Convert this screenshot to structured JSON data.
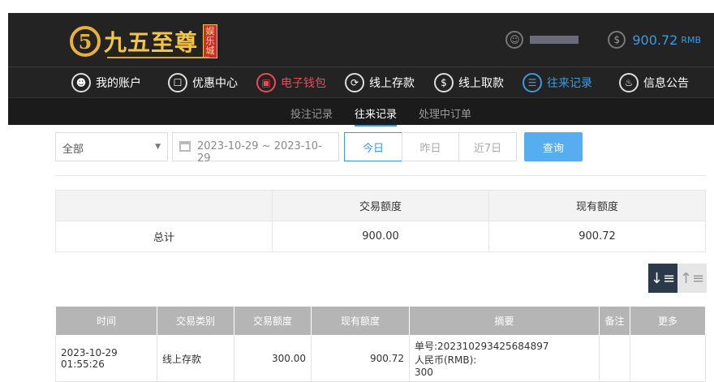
{
  "brand": {
    "mark": "5",
    "name": "九五至尊",
    "badge": "娱乐城"
  },
  "account": {
    "balance": "900.72",
    "currency": "RMB"
  },
  "nav": {
    "items": [
      {
        "label": "我的账户",
        "icon": "user-icon"
      },
      {
        "label": "优惠中心",
        "icon": "gift-icon"
      },
      {
        "label": "电子钱包",
        "icon": "wallet-icon"
      },
      {
        "label": "线上存款",
        "icon": "deposit-icon"
      },
      {
        "label": "线上取款",
        "icon": "withdraw-icon"
      },
      {
        "label": "往来记录",
        "icon": "records-icon"
      },
      {
        "label": "信息公告",
        "icon": "bell-icon"
      }
    ]
  },
  "subnav": {
    "tabs": [
      "投注记录",
      "往来记录",
      "处理中订单"
    ]
  },
  "filters": {
    "type_selected": "全部",
    "date_range": "2023-10-29 ~ 2023-10-29",
    "quick": [
      "今日",
      "昨日",
      "近7日"
    ],
    "search_label": "查询"
  },
  "summary": {
    "headers": [
      "",
      "交易额度",
      "现有额度"
    ],
    "row": [
      "总计",
      "900.00",
      "900.72"
    ]
  },
  "records": {
    "headers": [
      "时间",
      "交易类别",
      "交易额度",
      "现有额度",
      "摘要",
      "备注",
      "更多"
    ],
    "rows": [
      {
        "time": "2023-10-29 01:55:26",
        "type": "线上存款",
        "amount": "300.00",
        "balance": "900.72",
        "summary_line1": "单号:202310293425684897",
        "summary_line2": "人民币(RMB):",
        "summary_line3": "300",
        "note": "",
        "more": ""
      }
    ]
  },
  "colors": {
    "accent": "#3a9be0",
    "active_red": "#e94b57",
    "header_bg": "#232323",
    "gold": "#f5c542"
  }
}
